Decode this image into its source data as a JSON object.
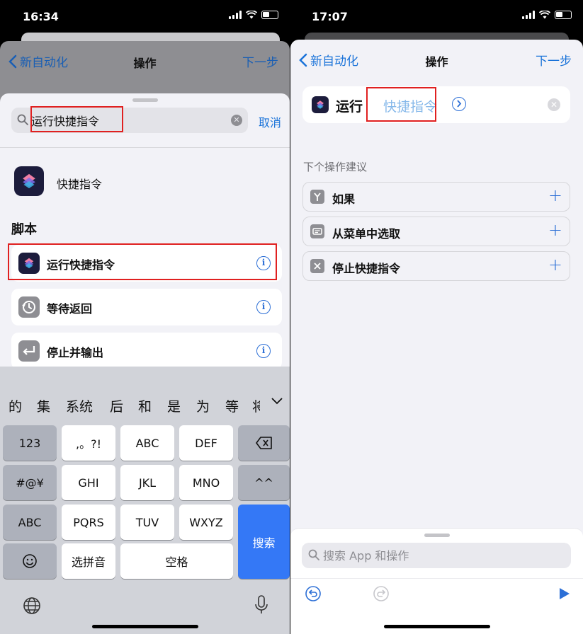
{
  "left": {
    "status": {
      "time": "16:34"
    },
    "nav": {
      "back": "新自动化",
      "title": "操作",
      "next": "下一步"
    },
    "search": {
      "value": "运行快捷指令",
      "cancel": "取消"
    },
    "app_result": {
      "label": "快捷指令"
    },
    "section": "脚本",
    "actions": [
      {
        "label": "运行快捷指令",
        "icon": "shortcuts-icon"
      },
      {
        "label": "等待返回",
        "icon": "history-icon"
      },
      {
        "label": "停止并输出",
        "icon": "return-icon"
      }
    ],
    "keyboard": {
      "candidates": [
        "的",
        "集",
        "系统",
        "后",
        "和",
        "是",
        "为",
        "等",
        "将"
      ],
      "row1": [
        "123",
        ",。?!",
        "ABC",
        "DEF"
      ],
      "row2": [
        "#@¥",
        "GHI",
        "JKL",
        "MNO",
        "^^"
      ],
      "row3": [
        "ABC",
        "PQRS",
        "TUV",
        "WXYZ"
      ],
      "row4": [
        "选拼音",
        "空格"
      ],
      "search_key": "搜索"
    }
  },
  "right": {
    "status": {
      "time": "17:07"
    },
    "nav": {
      "back": "新自动化",
      "title": "操作",
      "next": "下一步"
    },
    "run_action": {
      "label": "运行",
      "param": "快捷指令"
    },
    "suggestions_title": "下个操作建议",
    "suggestions": [
      {
        "label": "如果",
        "icon": "branch-icon"
      },
      {
        "label": "从菜单中选取",
        "icon": "menu-icon"
      },
      {
        "label": "停止快捷指令",
        "icon": "stop-icon"
      }
    ],
    "bottom_search": {
      "placeholder": "搜索 App 和操作"
    }
  },
  "colors": {
    "accent": "#1a73d9",
    "highlight": "#e02020",
    "search_key": "#3478f6"
  }
}
